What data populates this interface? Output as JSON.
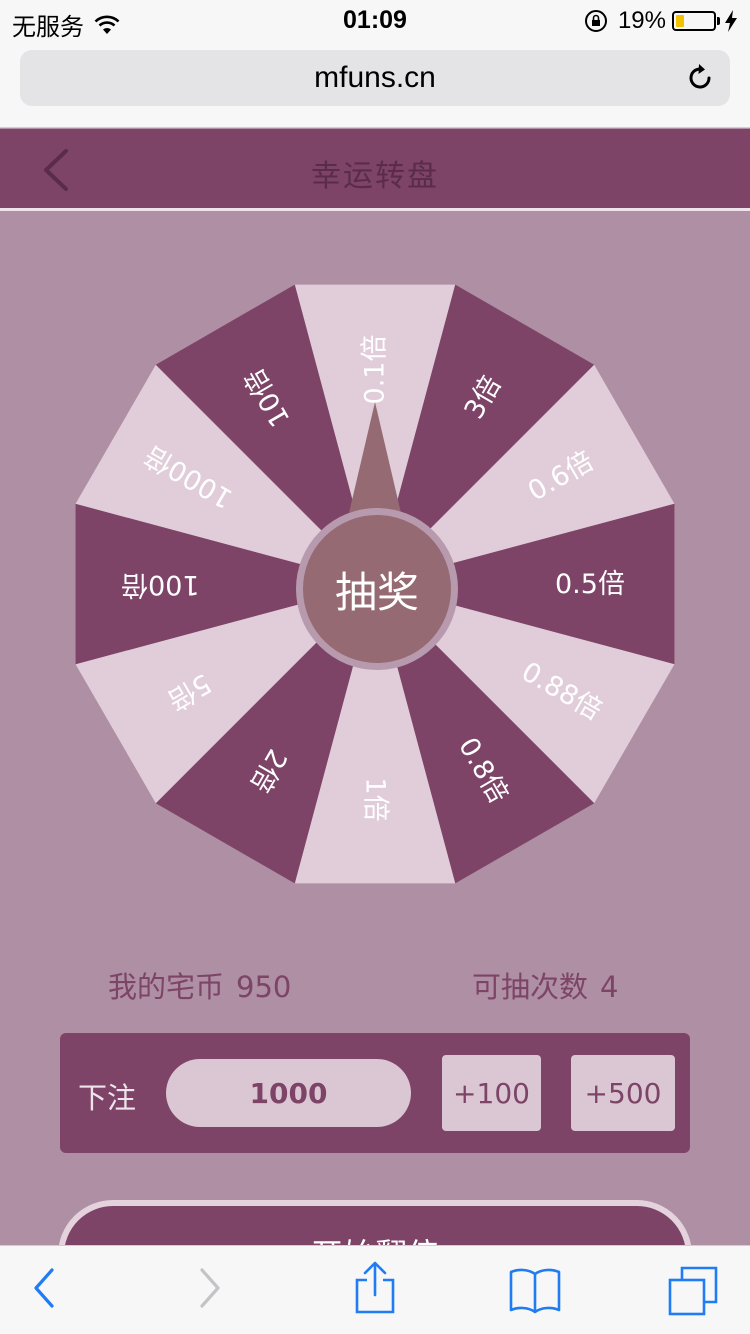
{
  "status_bar": {
    "carrier": "无服务",
    "time": "01:09",
    "battery_percent": "19%",
    "battery_level": 0.19
  },
  "browser": {
    "url": "mfuns.cn"
  },
  "header": {
    "title": "幸运转盘"
  },
  "wheel": {
    "prizes": [
      "0.1倍",
      "3倍",
      "0.6倍",
      "0.5倍",
      "0.88倍",
      "0.8倍",
      "1倍",
      "2倍",
      "5倍",
      "100倍",
      "1000倍",
      "10倍"
    ],
    "colors": {
      "dark": "#7d4467",
      "light": "#e1cdd9",
      "pointer": "#956a72"
    },
    "draw_button_label": "抽奖"
  },
  "info": {
    "coins_label": "我的宅币",
    "coins_value": "950",
    "draws_label": "可抽次数",
    "draws_value": "4"
  },
  "bet": {
    "label": "下注",
    "value": "1000",
    "add_100_label": "+100",
    "add_500_label": "+500"
  },
  "start_button_label": "开始翻倍"
}
